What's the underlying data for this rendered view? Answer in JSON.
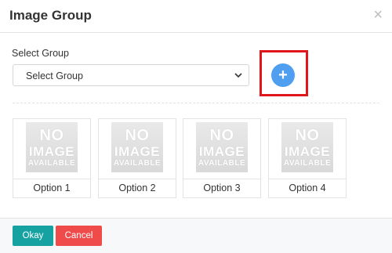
{
  "modal": {
    "title": "Image Group",
    "close": "×"
  },
  "form": {
    "label": "Select Group",
    "select_value": "Select Group",
    "add_symbol": "+"
  },
  "options": [
    {
      "label": "Option 1",
      "placeholder_lines": [
        "NO",
        "IMAGE",
        "AVAILABLE"
      ]
    },
    {
      "label": "Option 2",
      "placeholder_lines": [
        "NO",
        "IMAGE",
        "AVAILABLE"
      ]
    },
    {
      "label": "Option 3",
      "placeholder_lines": [
        "NO",
        "IMAGE",
        "AVAILABLE"
      ]
    },
    {
      "label": "Option 4",
      "placeholder_lines": [
        "NO",
        "IMAGE",
        "AVAILABLE"
      ]
    }
  ],
  "footer": {
    "okay_label": "Okay",
    "cancel_label": "Cancel"
  },
  "colors": {
    "add_button": "#4f9ef0",
    "highlight": "#e1161b",
    "okay": "#17a2a2",
    "cancel": "#ef4b4b"
  }
}
